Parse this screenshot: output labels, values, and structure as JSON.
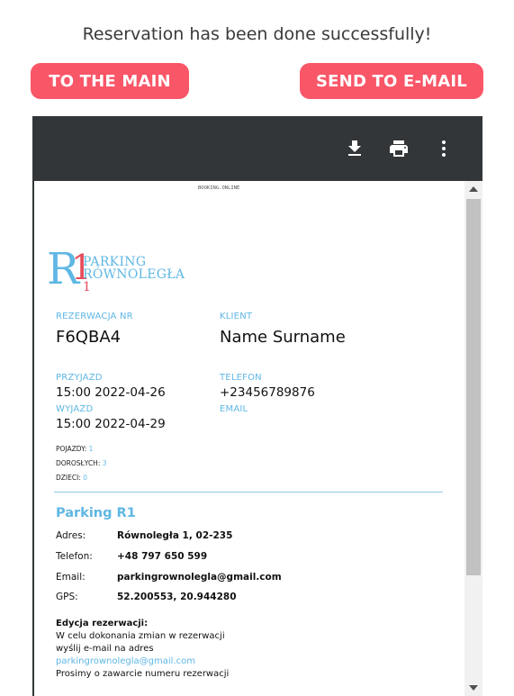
{
  "message": "Reservation has been done successfully!",
  "buttons": {
    "to_main": "TO THE MAIN",
    "send_email": "SEND TO E-MAIL"
  },
  "viewer": {
    "toolbar_icons": [
      "download-icon",
      "print-icon",
      "more-vert-icon"
    ],
    "page": {
      "header_small": "BOOKING.ONLINE",
      "logo": {
        "mark": "R1",
        "line1": "PARKING",
        "line2": "RÓWNOLEGŁA",
        "number": "1"
      },
      "reservation_label": "REZERWACJA NR",
      "reservation_value": "F6QBA4",
      "client_label": "KLIENT",
      "client_value": "Name Surname",
      "arrival_label": "PRZYJAZD",
      "arrival_value": "15:00 2022-04-26",
      "phone_label": "TELEFON",
      "phone_value": "+23456789876",
      "departure_label": "WYJAZD",
      "departure_value": "15:00 2022-04-29",
      "email_label": "EMAIL",
      "vehicles_label": "POJAZDY:",
      "vehicles_value": "1",
      "adults_label": "DOROSŁYCH:",
      "adults_value": "3",
      "children_label": "DZIECI:",
      "children_value": "0",
      "parking_title": "Parking R1",
      "details": [
        {
          "key": "Adres:",
          "value": "Równoległa 1, 02-235"
        },
        {
          "key": "Telefon:",
          "value": "+48 797 650 599"
        },
        {
          "key": "Email:",
          "value": "parkingrownolegla@gmail.com"
        },
        {
          "key": "GPS:",
          "value": "52.200553, 20.944280"
        }
      ],
      "edit_title": "Edycja rezerwacji:",
      "edit_line1": "W celu dokonania zmian w rezerwacji",
      "edit_line2": "wyślij e-mail na adres",
      "edit_email": "parkingrownolegla@gmail.com",
      "edit_line3": "Prosimy o zawarcie numeru rezerwacji"
    }
  },
  "colors": {
    "accent": "#f95668",
    "brand_blue": "#5fb7e4",
    "toolbar_bg": "#323639"
  }
}
